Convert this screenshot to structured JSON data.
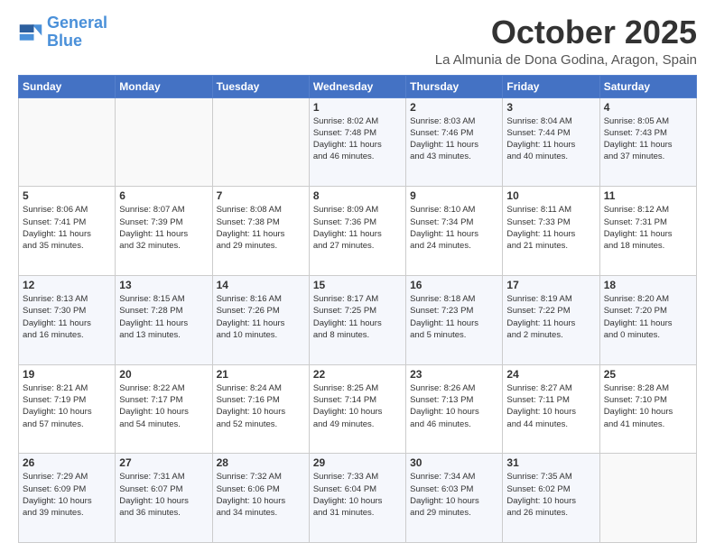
{
  "logo": {
    "line1": "General",
    "line2": "Blue"
  },
  "header": {
    "month": "October 2025",
    "location": "La Almunia de Dona Godina, Aragon, Spain"
  },
  "weekdays": [
    "Sunday",
    "Monday",
    "Tuesday",
    "Wednesday",
    "Thursday",
    "Friday",
    "Saturday"
  ],
  "weeks": [
    [
      {
        "day": "",
        "info": ""
      },
      {
        "day": "",
        "info": ""
      },
      {
        "day": "",
        "info": ""
      },
      {
        "day": "1",
        "info": "Sunrise: 8:02 AM\nSunset: 7:48 PM\nDaylight: 11 hours\nand 46 minutes."
      },
      {
        "day": "2",
        "info": "Sunrise: 8:03 AM\nSunset: 7:46 PM\nDaylight: 11 hours\nand 43 minutes."
      },
      {
        "day": "3",
        "info": "Sunrise: 8:04 AM\nSunset: 7:44 PM\nDaylight: 11 hours\nand 40 minutes."
      },
      {
        "day": "4",
        "info": "Sunrise: 8:05 AM\nSunset: 7:43 PM\nDaylight: 11 hours\nand 37 minutes."
      }
    ],
    [
      {
        "day": "5",
        "info": "Sunrise: 8:06 AM\nSunset: 7:41 PM\nDaylight: 11 hours\nand 35 minutes."
      },
      {
        "day": "6",
        "info": "Sunrise: 8:07 AM\nSunset: 7:39 PM\nDaylight: 11 hours\nand 32 minutes."
      },
      {
        "day": "7",
        "info": "Sunrise: 8:08 AM\nSunset: 7:38 PM\nDaylight: 11 hours\nand 29 minutes."
      },
      {
        "day": "8",
        "info": "Sunrise: 8:09 AM\nSunset: 7:36 PM\nDaylight: 11 hours\nand 27 minutes."
      },
      {
        "day": "9",
        "info": "Sunrise: 8:10 AM\nSunset: 7:34 PM\nDaylight: 11 hours\nand 24 minutes."
      },
      {
        "day": "10",
        "info": "Sunrise: 8:11 AM\nSunset: 7:33 PM\nDaylight: 11 hours\nand 21 minutes."
      },
      {
        "day": "11",
        "info": "Sunrise: 8:12 AM\nSunset: 7:31 PM\nDaylight: 11 hours\nand 18 minutes."
      }
    ],
    [
      {
        "day": "12",
        "info": "Sunrise: 8:13 AM\nSunset: 7:30 PM\nDaylight: 11 hours\nand 16 minutes."
      },
      {
        "day": "13",
        "info": "Sunrise: 8:15 AM\nSunset: 7:28 PM\nDaylight: 11 hours\nand 13 minutes."
      },
      {
        "day": "14",
        "info": "Sunrise: 8:16 AM\nSunset: 7:26 PM\nDaylight: 11 hours\nand 10 minutes."
      },
      {
        "day": "15",
        "info": "Sunrise: 8:17 AM\nSunset: 7:25 PM\nDaylight: 11 hours\nand 8 minutes."
      },
      {
        "day": "16",
        "info": "Sunrise: 8:18 AM\nSunset: 7:23 PM\nDaylight: 11 hours\nand 5 minutes."
      },
      {
        "day": "17",
        "info": "Sunrise: 8:19 AM\nSunset: 7:22 PM\nDaylight: 11 hours\nand 2 minutes."
      },
      {
        "day": "18",
        "info": "Sunrise: 8:20 AM\nSunset: 7:20 PM\nDaylight: 11 hours\nand 0 minutes."
      }
    ],
    [
      {
        "day": "19",
        "info": "Sunrise: 8:21 AM\nSunset: 7:19 PM\nDaylight: 10 hours\nand 57 minutes."
      },
      {
        "day": "20",
        "info": "Sunrise: 8:22 AM\nSunset: 7:17 PM\nDaylight: 10 hours\nand 54 minutes."
      },
      {
        "day": "21",
        "info": "Sunrise: 8:24 AM\nSunset: 7:16 PM\nDaylight: 10 hours\nand 52 minutes."
      },
      {
        "day": "22",
        "info": "Sunrise: 8:25 AM\nSunset: 7:14 PM\nDaylight: 10 hours\nand 49 minutes."
      },
      {
        "day": "23",
        "info": "Sunrise: 8:26 AM\nSunset: 7:13 PM\nDaylight: 10 hours\nand 46 minutes."
      },
      {
        "day": "24",
        "info": "Sunrise: 8:27 AM\nSunset: 7:11 PM\nDaylight: 10 hours\nand 44 minutes."
      },
      {
        "day": "25",
        "info": "Sunrise: 8:28 AM\nSunset: 7:10 PM\nDaylight: 10 hours\nand 41 minutes."
      }
    ],
    [
      {
        "day": "26",
        "info": "Sunrise: 7:29 AM\nSunset: 6:09 PM\nDaylight: 10 hours\nand 39 minutes."
      },
      {
        "day": "27",
        "info": "Sunrise: 7:31 AM\nSunset: 6:07 PM\nDaylight: 10 hours\nand 36 minutes."
      },
      {
        "day": "28",
        "info": "Sunrise: 7:32 AM\nSunset: 6:06 PM\nDaylight: 10 hours\nand 34 minutes."
      },
      {
        "day": "29",
        "info": "Sunrise: 7:33 AM\nSunset: 6:04 PM\nDaylight: 10 hours\nand 31 minutes."
      },
      {
        "day": "30",
        "info": "Sunrise: 7:34 AM\nSunset: 6:03 PM\nDaylight: 10 hours\nand 29 minutes."
      },
      {
        "day": "31",
        "info": "Sunrise: 7:35 AM\nSunset: 6:02 PM\nDaylight: 10 hours\nand 26 minutes."
      },
      {
        "day": "",
        "info": ""
      }
    ]
  ]
}
